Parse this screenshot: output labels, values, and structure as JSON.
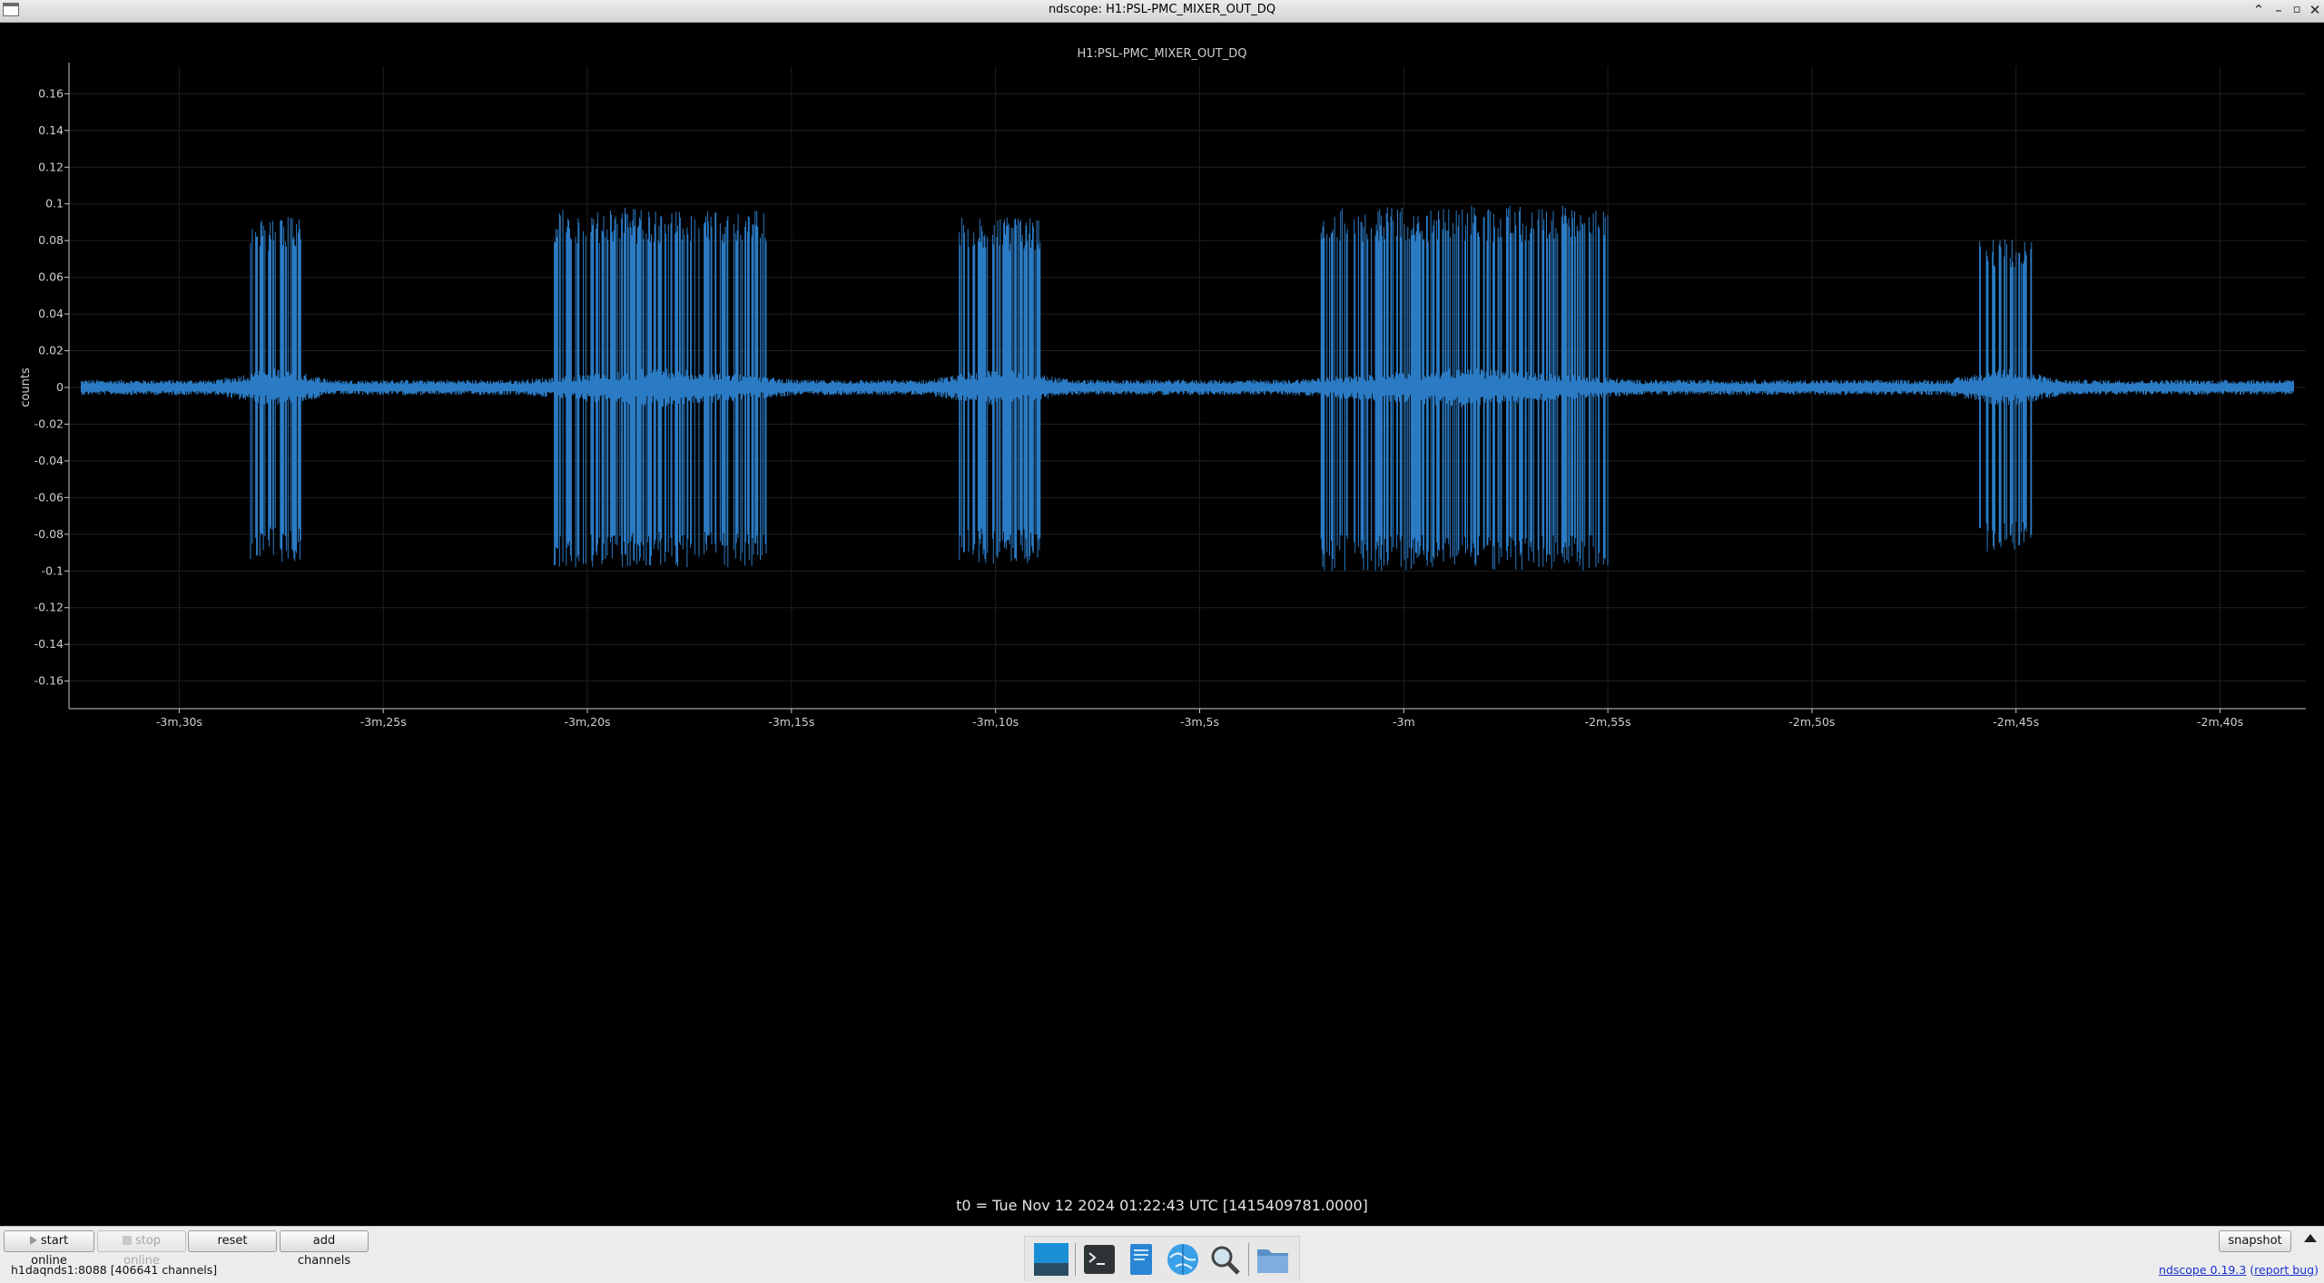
{
  "window": {
    "title": "ndscope: H1:PSL-PMC_MIXER_OUT_DQ"
  },
  "colors": {
    "trace": "#2b7bc4",
    "background": "#000000",
    "axis": "#c8c8c8"
  },
  "chart_data": {
    "type": "line",
    "title": "H1:PSL-PMC_MIXER_OUT_DQ",
    "ylabel": "counts",
    "xlabel": "t0 = Tue Nov 12 2024 01:22:43 UTC [1415409781.0000]",
    "xlim": [
      -212.7,
      -157.9
    ],
    "ylim": [
      -0.175,
      0.175
    ],
    "x_ticks": [
      {
        "value": -210,
        "label": "-3m,30s"
      },
      {
        "value": -205,
        "label": "-3m,25s"
      },
      {
        "value": -200,
        "label": "-3m,20s"
      },
      {
        "value": -195,
        "label": "-3m,15s"
      },
      {
        "value": -190,
        "label": "-3m,10s"
      },
      {
        "value": -185,
        "label": "-3m,5s"
      },
      {
        "value": -180,
        "label": "-3m"
      },
      {
        "value": -175,
        "label": "-2m,55s"
      },
      {
        "value": -170,
        "label": "-2m,50s"
      },
      {
        "value": -165,
        "label": "-2m,45s"
      },
      {
        "value": -160,
        "label": "-2m,40s"
      }
    ],
    "y_ticks": [
      {
        "value": 0.16,
        "label": "0.16"
      },
      {
        "value": 0.14,
        "label": "0.14"
      },
      {
        "value": 0.12,
        "label": "0.12"
      },
      {
        "value": 0.1,
        "label": "0.1"
      },
      {
        "value": 0.08,
        "label": "0.08"
      },
      {
        "value": 0.06,
        "label": "0.06"
      },
      {
        "value": 0.04,
        "label": "0.04"
      },
      {
        "value": 0.02,
        "label": "0.02"
      },
      {
        "value": 0,
        "label": "0"
      },
      {
        "value": -0.02,
        "label": "-0.02"
      },
      {
        "value": -0.04,
        "label": "-0.04"
      },
      {
        "value": -0.06,
        "label": "-0.06"
      },
      {
        "value": -0.08,
        "label": "-0.08"
      },
      {
        "value": -0.1,
        "label": "-0.1"
      },
      {
        "value": -0.12,
        "label": "-0.12"
      },
      {
        "value": -0.14,
        "label": "-0.14"
      },
      {
        "value": -0.16,
        "label": "-0.16"
      }
    ],
    "grid": true,
    "series": [
      {
        "baseline_noise": 0.003,
        "bursts": [
          {
            "x_start": -208.3,
            "x_end": -207.0,
            "y_max": 0.093,
            "y_min": -0.095
          },
          {
            "x_start": -200.9,
            "x_end": -195.6,
            "y_max": 0.098,
            "y_min": -0.098
          },
          {
            "x_start": -190.9,
            "x_end": -188.9,
            "y_max": 0.093,
            "y_min": -0.096
          },
          {
            "x_start": -182.1,
            "x_end": -175.0,
            "y_max": 0.099,
            "y_min": -0.1
          },
          {
            "x_start": -165.9,
            "x_end": -164.6,
            "y_max": 0.081,
            "y_min": -0.09
          }
        ]
      }
    ]
  },
  "toolbar": {
    "start_online": "start online",
    "stop_online": "stop online",
    "reset": "reset",
    "add_channels": "add channels",
    "snapshot": "snapshot"
  },
  "status": {
    "server": "h1daqnds1:8088  [406641 channels]",
    "version_link": "ndscope 0.19.3",
    "report_bug_link": "report bug"
  },
  "taskbar": {
    "items": [
      "desktop-icon",
      "terminal-icon",
      "text-editor-icon",
      "web-browser-icon",
      "search-icon",
      "file-manager-icon"
    ]
  }
}
